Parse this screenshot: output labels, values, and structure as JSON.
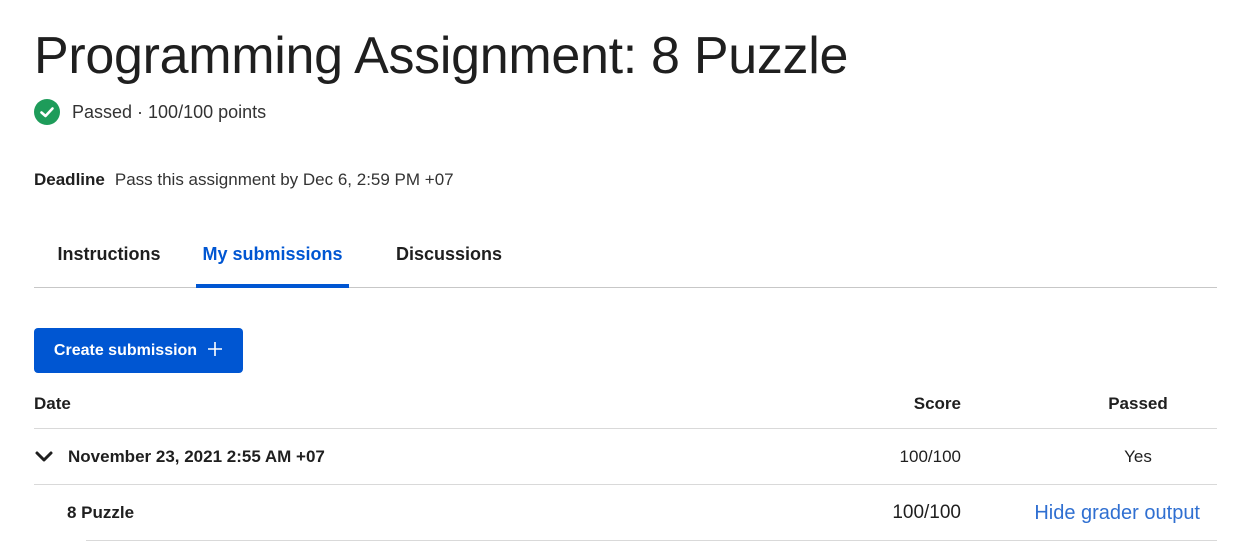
{
  "assignment": {
    "title": "Programming Assignment: 8 Puzzle",
    "status": "Passed · 100/100 points",
    "deadline_label": "Deadline",
    "deadline_text": "Pass this assignment by Dec 6, 2:59 PM +07"
  },
  "tabs": [
    {
      "label": "Instructions",
      "active": false
    },
    {
      "label": "My submissions",
      "active": true
    },
    {
      "label": "Discussions",
      "active": false
    }
  ],
  "create_button": {
    "label": "Create submission",
    "icon": "plus-icon"
  },
  "table": {
    "headers": {
      "date": "Date",
      "score": "Score",
      "passed": "Passed"
    },
    "submissions": [
      {
        "date": "November 23, 2021 2:55 AM +07",
        "score": "100/100",
        "passed": "Yes",
        "items": [
          {
            "name": "8 Puzzle",
            "score": "100/100",
            "link": "Hide grader output"
          }
        ]
      }
    ]
  },
  "colors": {
    "accent": "#0056d2",
    "success": "#1e9c5a",
    "link": "#2f6fd1"
  }
}
